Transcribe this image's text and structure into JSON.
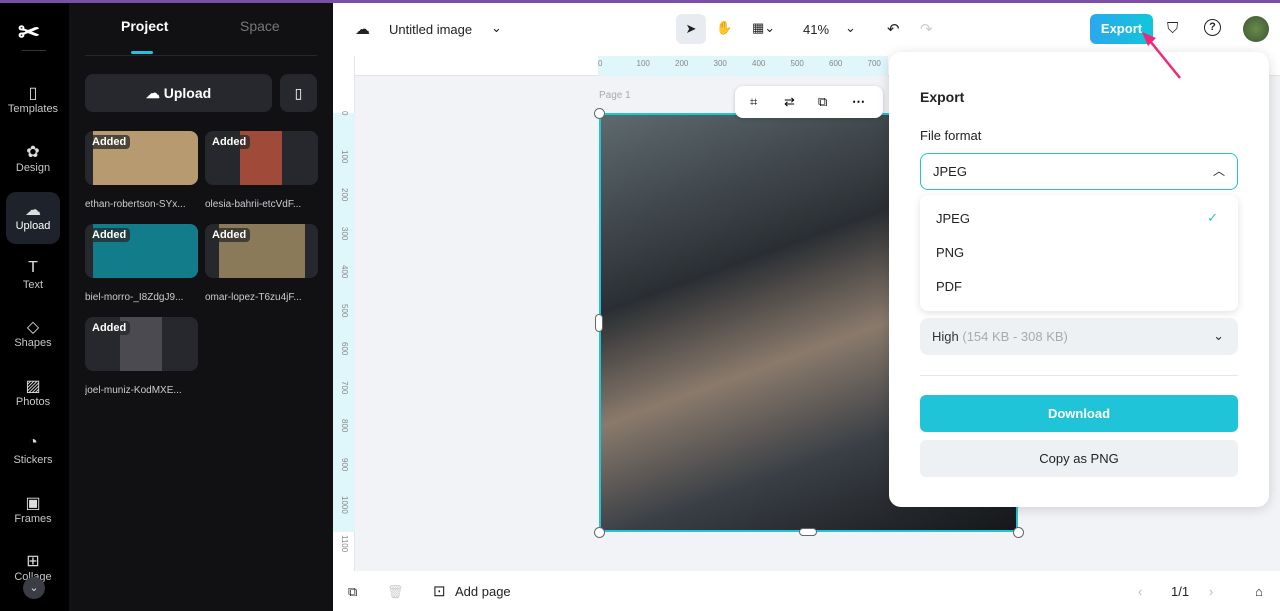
{
  "brand": {
    "accent": "#1fc4d8",
    "rail_bg": "#000000",
    "panel_bg": "#111114"
  },
  "rail": {
    "items": [
      {
        "label": "Templates",
        "icon": "templates-icon",
        "glyph": "▯"
      },
      {
        "label": "Design",
        "icon": "design-icon",
        "glyph": "✿"
      },
      {
        "label": "Upload",
        "icon": "cloud-upload-icon",
        "glyph": "☁"
      },
      {
        "label": "Text",
        "icon": "text-icon",
        "glyph": "T"
      },
      {
        "label": "Shapes",
        "icon": "shapes-icon",
        "glyph": "◇"
      },
      {
        "label": "Photos",
        "icon": "photos-icon",
        "glyph": "▨"
      },
      {
        "label": "Stickers",
        "icon": "stickers-icon",
        "glyph": "◔"
      },
      {
        "label": "Frames",
        "icon": "frames-icon",
        "glyph": "▣"
      },
      {
        "label": "Collage",
        "icon": "collage-icon",
        "glyph": "⊞"
      }
    ]
  },
  "panel": {
    "tabs": [
      "Project",
      "Space"
    ],
    "upload_label": "Upload",
    "badge": "Added",
    "files": [
      {
        "name": "ethan-robertson-SYx...",
        "color": "#b89a70"
      },
      {
        "name": "olesia-bahrii-etcVdF...",
        "color": "#a04a3a"
      },
      {
        "name": "biel-morro-_I8ZdgJ9...",
        "color": "#127c8a"
      },
      {
        "name": "omar-lopez-T6zu4jF...",
        "color": "#8a7a5a"
      },
      {
        "name": "joel-muniz-KodMXE...",
        "color": "#4a4a50"
      }
    ]
  },
  "header": {
    "title": "Untitled image",
    "zoom": "41%",
    "export_label": "Export"
  },
  "ruler": {
    "h": [
      "0",
      "100",
      "200",
      "300",
      "400",
      "500",
      "600",
      "700"
    ],
    "v": [
      "0",
      "100",
      "200",
      "300",
      "400",
      "500",
      "600",
      "700",
      "800",
      "900",
      "1000",
      "1100"
    ]
  },
  "canvas": {
    "page_label": "Page 1"
  },
  "bottom": {
    "add_page": "Add page",
    "page_counter": "1/1"
  },
  "export_popup": {
    "title": "Export",
    "file_format_label": "File format",
    "selected": "JPEG",
    "options": [
      "JPEG",
      "PNG",
      "PDF"
    ],
    "quality": "High",
    "quality_size": "(154 KB - 308 KB)",
    "download": "Download",
    "copy": "Copy as PNG"
  }
}
